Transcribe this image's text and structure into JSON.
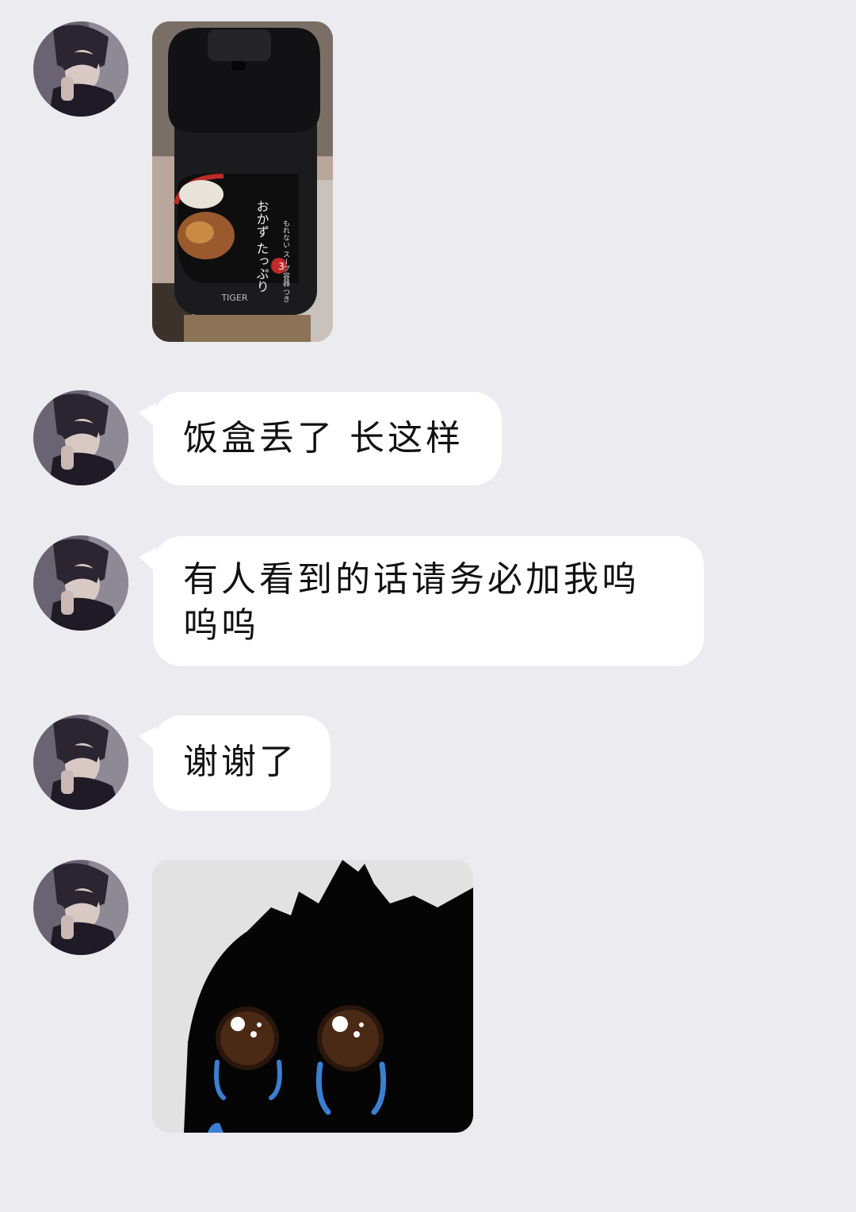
{
  "chat": {
    "messages": [
      {
        "type": "image",
        "content": "thermos-lunch-jar-photo"
      },
      {
        "type": "text",
        "text": "饭盒丢了 长这样"
      },
      {
        "type": "text",
        "text": "有人看到的话请务必加我呜呜呜"
      },
      {
        "type": "text",
        "text": "谢谢了"
      },
      {
        "type": "image",
        "content": "crying-black-cat-sticker"
      }
    ],
    "photo": {
      "brand": "TIGER",
      "label_main": "おかず たっぷり",
      "label_sub": "もれない スープ容器 つき",
      "badge": "3"
    }
  },
  "colors": {
    "background": "#ebebf0",
    "bubble": "#ffffff",
    "text": "#111111",
    "tear": "#3a7fd1"
  }
}
